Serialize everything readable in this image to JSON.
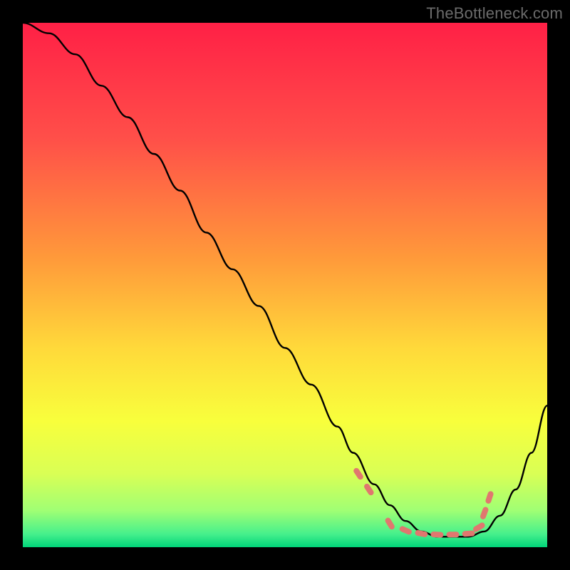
{
  "watermark": "TheBottleneck.com",
  "chart_data": {
    "type": "line",
    "title": "",
    "xlabel": "",
    "ylabel": "",
    "xlim": [
      0,
      100
    ],
    "ylim": [
      0,
      100
    ],
    "grid": false,
    "gradient_stops": [
      {
        "offset": 0.0,
        "color": "#ff2046"
      },
      {
        "offset": 0.22,
        "color": "#ff4f49"
      },
      {
        "offset": 0.45,
        "color": "#ff9a3a"
      },
      {
        "offset": 0.62,
        "color": "#ffd93a"
      },
      {
        "offset": 0.76,
        "color": "#f8ff3c"
      },
      {
        "offset": 0.86,
        "color": "#d9ff55"
      },
      {
        "offset": 0.93,
        "color": "#a0ff74"
      },
      {
        "offset": 0.975,
        "color": "#46f08c"
      },
      {
        "offset": 1.0,
        "color": "#00d47a"
      }
    ],
    "series": [
      {
        "name": "bottleneck-curve",
        "stroke": "#000000",
        "stroke_width": 2.4,
        "x": [
          0,
          5,
          10,
          15,
          20,
          25,
          30,
          35,
          40,
          45,
          50,
          55,
          60,
          63,
          67,
          70,
          73,
          76,
          79,
          82,
          85,
          88,
          91,
          94,
          97,
          100
        ],
        "y": [
          100,
          98,
          94,
          88,
          82,
          75,
          68,
          60,
          53,
          46,
          38,
          31,
          23,
          18,
          12,
          8,
          5,
          3,
          2,
          2,
          2,
          3,
          6,
          11,
          18,
          27
        ]
      },
      {
        "name": "optimal-range-marker",
        "type": "scatter",
        "marker_shape": "rounded-dash",
        "color": "#e0776f",
        "x": [
          64,
          66,
          70,
          73,
          76,
          79,
          82,
          85,
          87,
          88,
          89
        ],
        "y": [
          14,
          11,
          4.5,
          3.2,
          2.6,
          2.4,
          2.4,
          2.6,
          3.8,
          6.5,
          9.5
        ]
      }
    ]
  }
}
